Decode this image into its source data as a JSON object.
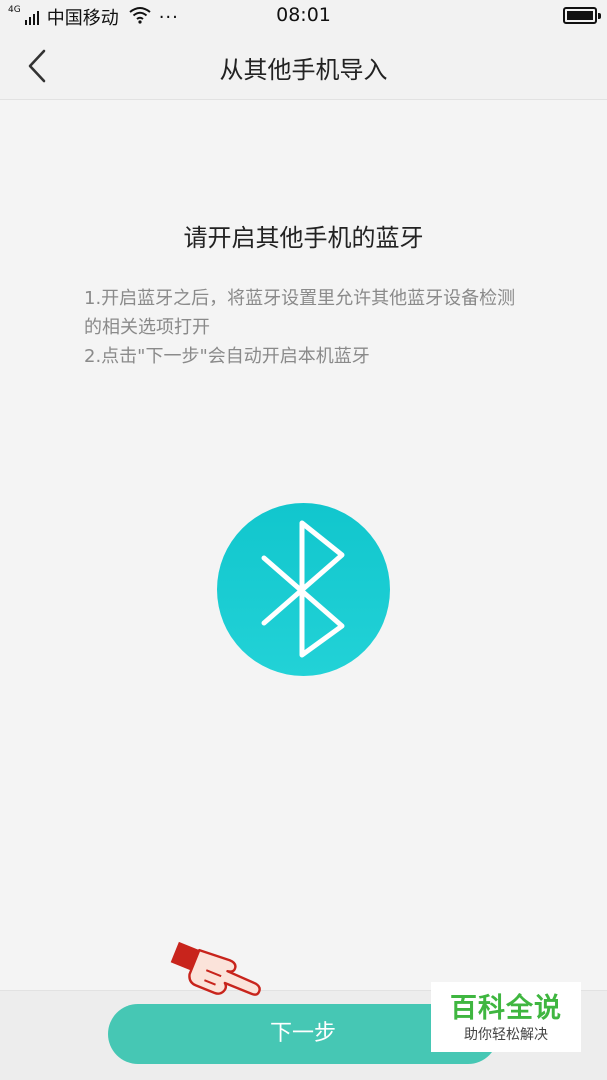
{
  "status_bar": {
    "network_type": "4G",
    "carrier": "中国移动",
    "more_dots": "···",
    "time": "08:01"
  },
  "header": {
    "title": "从其他手机导入",
    "back_icon": "chevron-left-icon"
  },
  "content": {
    "heading": "请开启其他手机的蓝牙",
    "instructions": [
      "1.开启蓝牙之后，将蓝牙设置里允许其他蓝牙设备检测的相关选项打开",
      "2.点击\"下一步\"会自动开启本机蓝牙"
    ],
    "bluetooth_icon": "bluetooth-icon",
    "accent_color": "#11c6cd"
  },
  "footer": {
    "next_label": "下一步",
    "button_color": "#46c7b4"
  },
  "watermark": {
    "title": "百科全说",
    "subtitle": "助你轻松解决"
  }
}
